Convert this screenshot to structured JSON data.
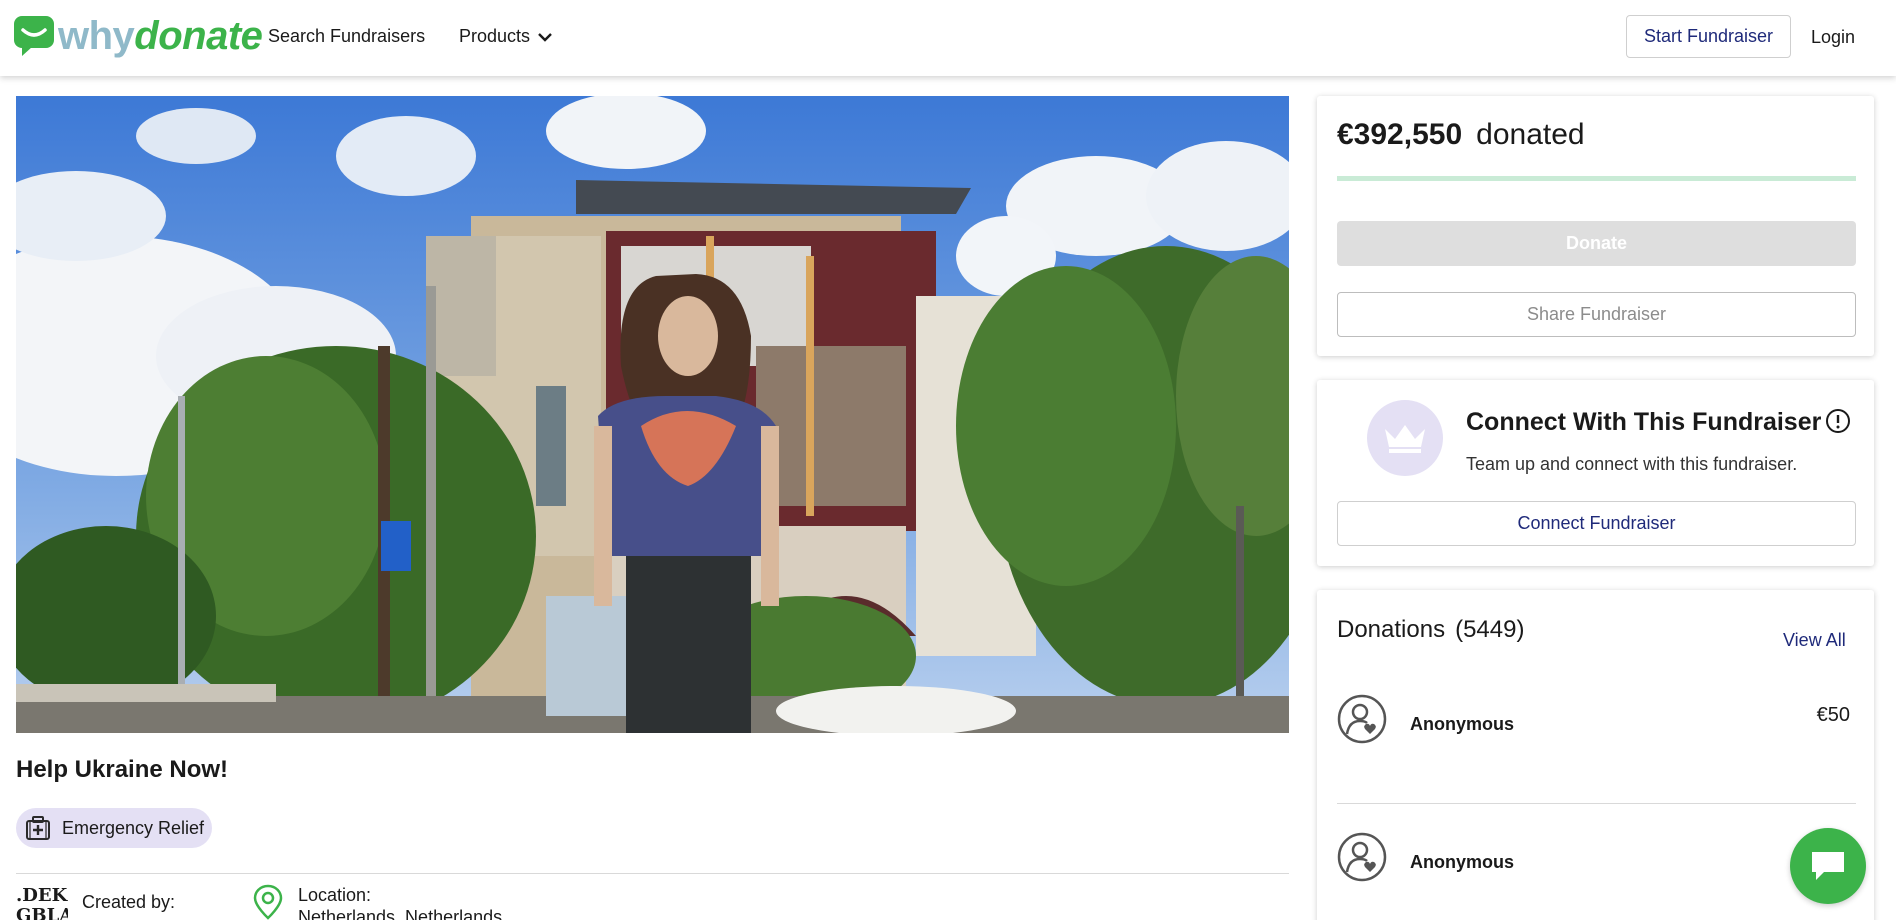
{
  "header": {
    "logo_why": "why",
    "logo_donate": "donate",
    "nav_search": "Search Fundraisers",
    "nav_products": "Products",
    "start_button": "Start Fundraiser",
    "login": "Login"
  },
  "fundraiser": {
    "title": "Help Ukraine Now!",
    "category": "Emergency Relief",
    "created_by_label": "Created by:",
    "creator_logo_text": ".DEK GBLA",
    "location_label": "Location:",
    "location_value": "Netherlands, Netherlands"
  },
  "donation_card": {
    "amount": "€392,550",
    "donated_label": "donated",
    "donate_button": "Donate",
    "share_button": "Share Fundraiser"
  },
  "connect_card": {
    "title": "Connect With This Fundraiser",
    "subtitle": "Team up and connect with this fundraiser.",
    "button": "Connect Fundraiser"
  },
  "donations": {
    "title": "Donations",
    "count": "(5449)",
    "view_all": "View All",
    "items": [
      {
        "name": "Anonymous",
        "amount": "€50"
      },
      {
        "name": "Anonymous",
        "amount": ""
      }
    ]
  },
  "colors": {
    "brand_green": "#3cb34a",
    "brand_blue": "#8fb9c9",
    "accent_navy": "#1f2a7a",
    "lavender": "#e4e0f4",
    "progress": "#c9ebd6"
  },
  "icons": {
    "logo": "chat-bubble-logo-icon",
    "products_dropdown": "chevron-down-icon",
    "category": "first-aid-kit-icon",
    "location": "map-pin-icon",
    "connect": "crown-icon",
    "info": "info-icon",
    "donor_avatar": "user-heart-icon",
    "chat": "chat-icon"
  }
}
